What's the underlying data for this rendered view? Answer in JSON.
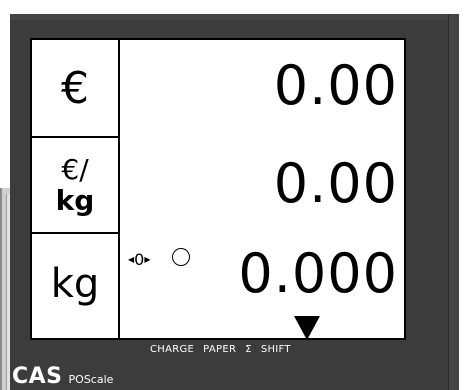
{
  "display": {
    "price": {
      "unit": "€",
      "value": "0.00"
    },
    "unit_price": {
      "unit_top": "€/",
      "unit_bottom": "kg",
      "value": "0.00"
    },
    "weight": {
      "unit": "kg",
      "value": "0.000"
    },
    "zero_indicator": "0"
  },
  "labels": [
    "CHARGE",
    "PAPER",
    "Σ",
    "SHIFT"
  ],
  "brand": {
    "name": "CAS",
    "model": "POScale"
  }
}
